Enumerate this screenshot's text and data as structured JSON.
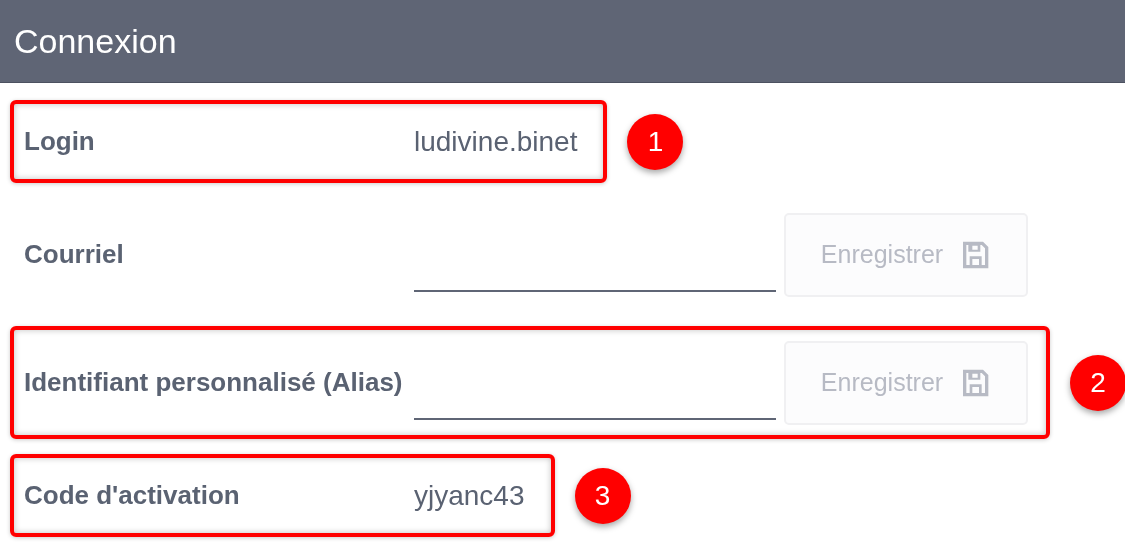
{
  "header": {
    "title": "Connexion"
  },
  "rows": [
    {
      "kind": "value",
      "label": "Login",
      "value": "ludivine.binet",
      "highlighted": true,
      "callout": "1"
    },
    {
      "kind": "input",
      "label": "Courriel",
      "button": {
        "label": "Enregistrer",
        "disabled": true
      },
      "highlighted": false
    },
    {
      "kind": "input",
      "label": "Identifiant personnalisé (Alias)",
      "button": {
        "label": "Enregistrer",
        "disabled": true
      },
      "highlighted": true,
      "callout": "2"
    },
    {
      "kind": "value",
      "label": "Code d'activation",
      "value": "yjyanc43",
      "highlighted": true,
      "callout": "3"
    }
  ]
}
